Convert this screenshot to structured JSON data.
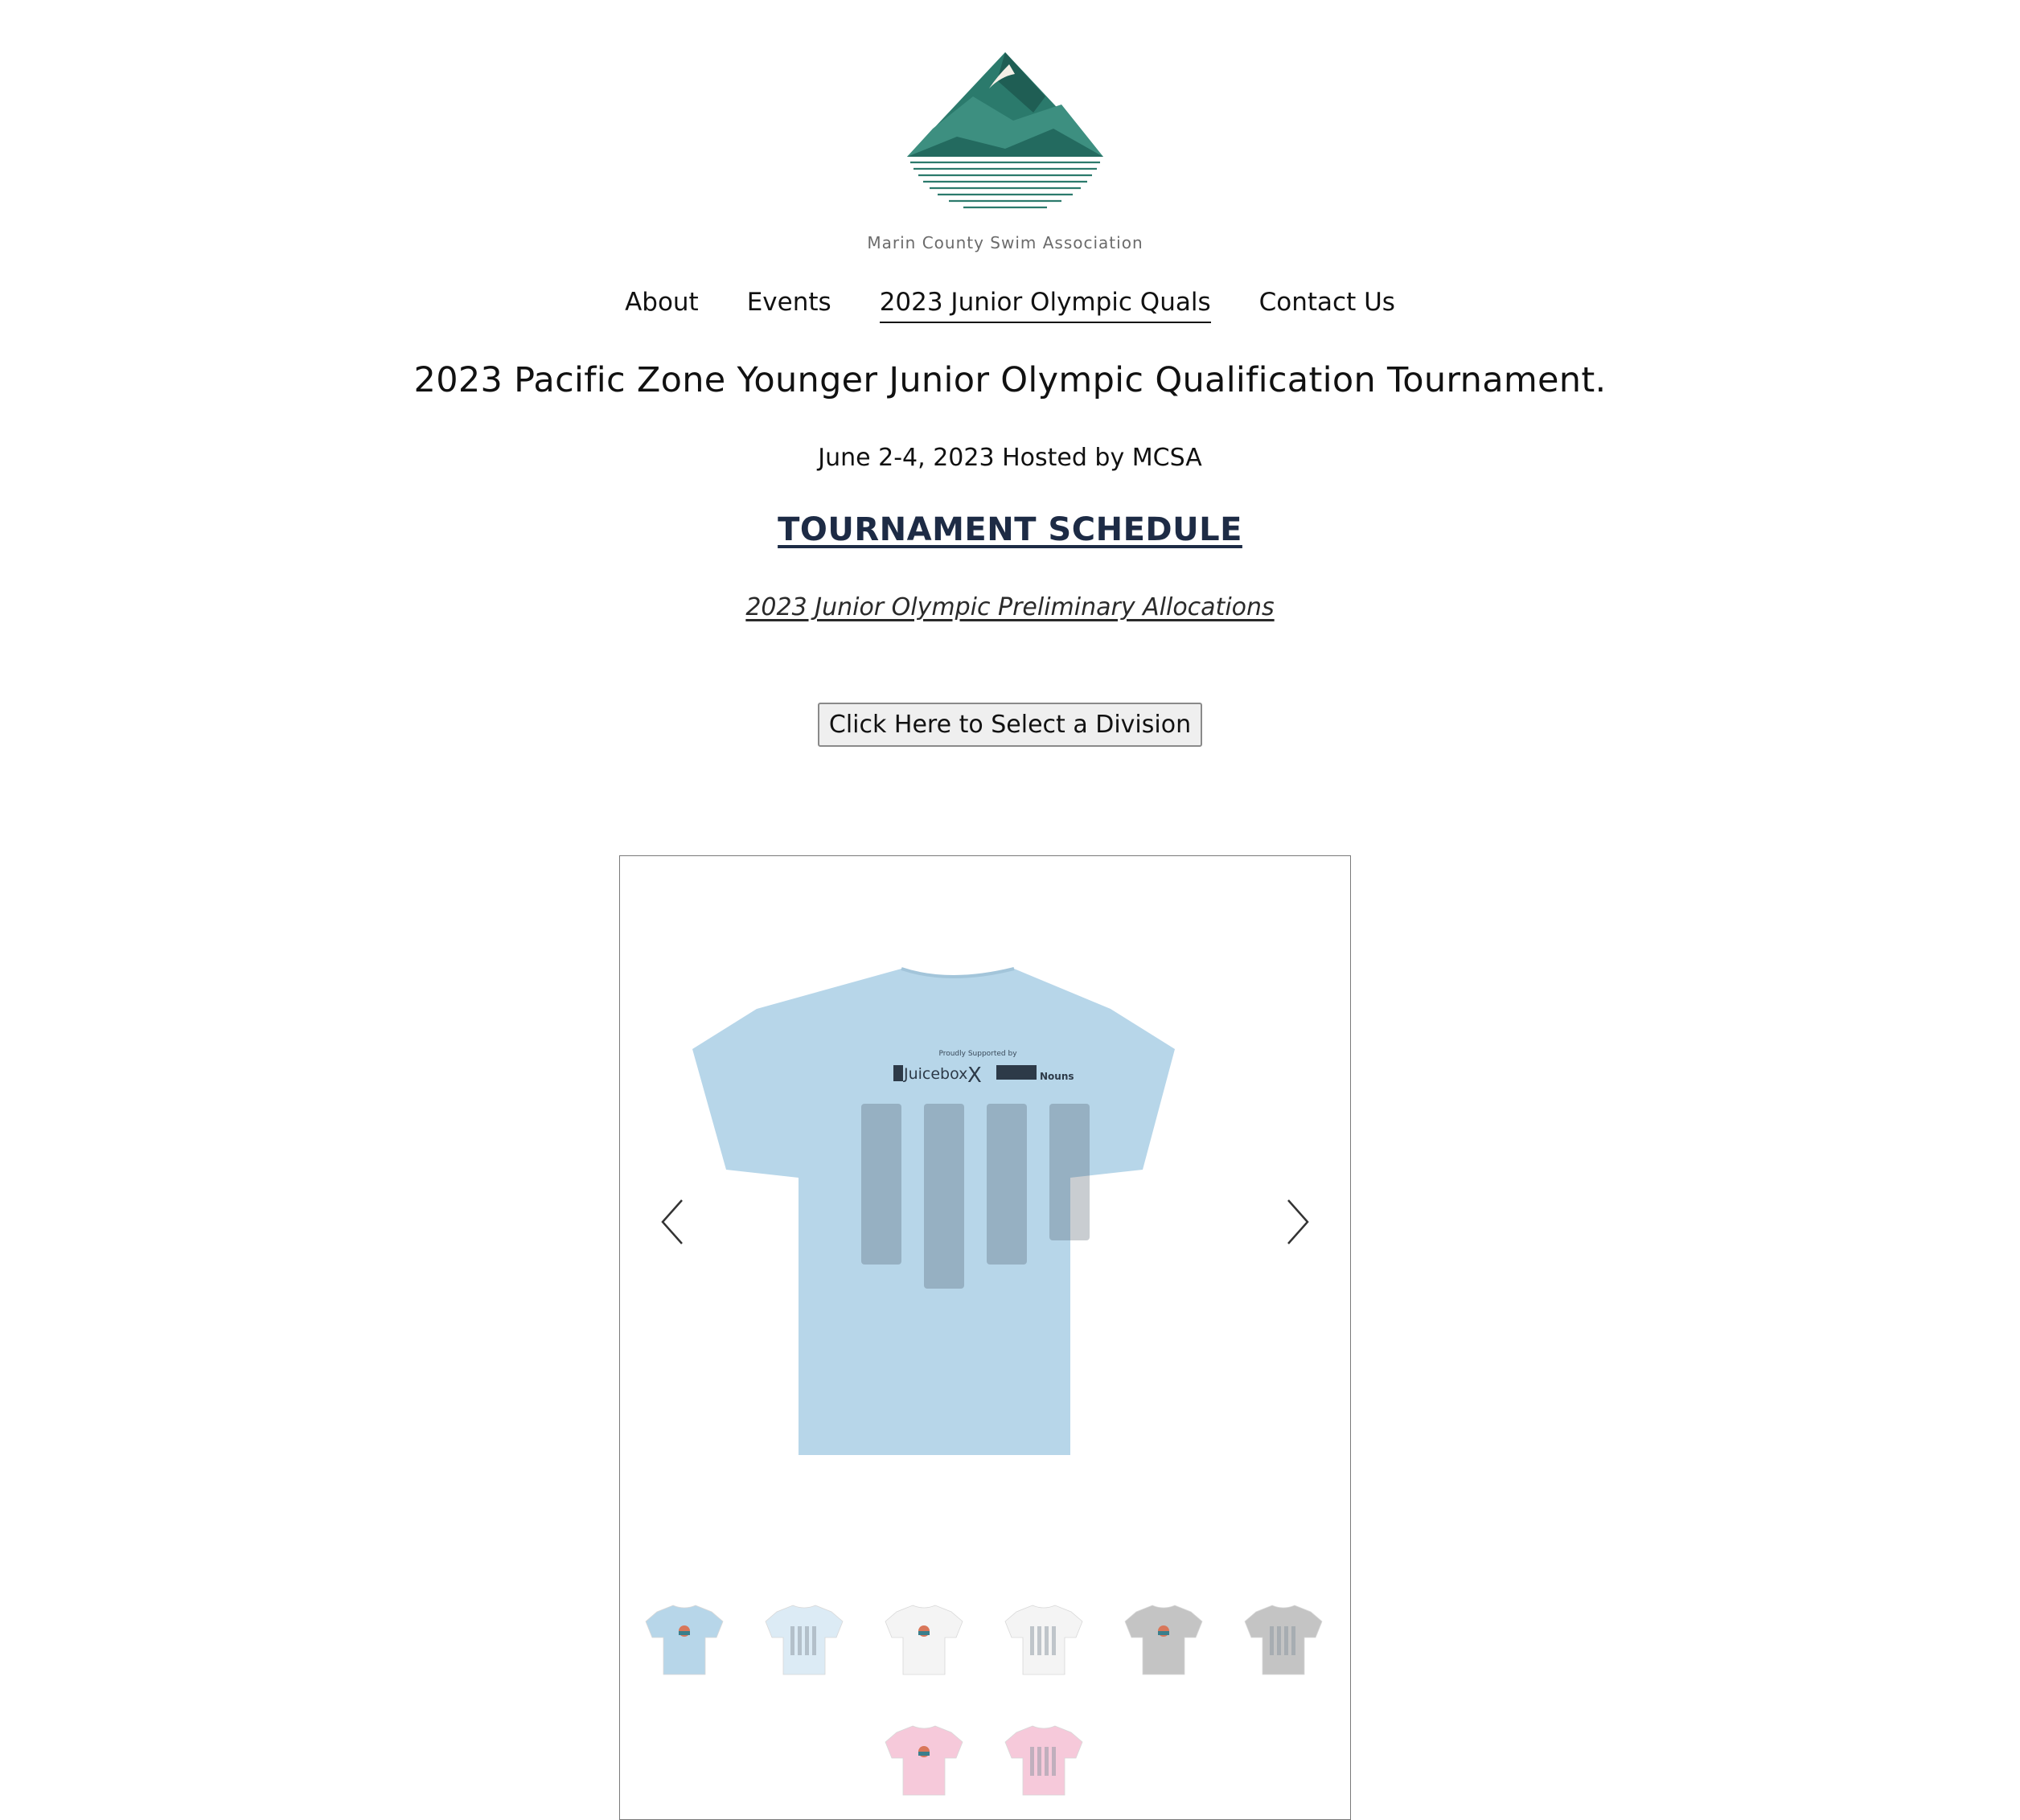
{
  "site": {
    "logo_text": "Marin County Swim Association"
  },
  "nav": {
    "items": [
      {
        "label": "About"
      },
      {
        "label": "Events"
      },
      {
        "label": "2023 Junior Olympic Quals",
        "active": true
      },
      {
        "label": "Contact Us"
      }
    ]
  },
  "main": {
    "title": "2023 Pacific Zone Younger Junior Olympic Qualification Tournament.",
    "subtitle": "June 2-4, 2023 Hosted by MCSA",
    "schedule_link": "TOURNAMENT SCHEDULE",
    "allocations_link": "2023 Junior Olympic Preliminary Allocations",
    "division_button": "Click Here to Select a Division"
  },
  "gallery": {
    "main_image": {
      "color": "#b7d6e9",
      "print_header": "Proudly Supported by",
      "sponsor_1": "Juicebox",
      "sponsor_separator": "X",
      "sponsor_2": "Nouns"
    },
    "prev_icon": "chevron-left-icon",
    "next_icon": "chevron-right-icon",
    "thumbnails": [
      {
        "color": "#b7d6e9",
        "side": "front"
      },
      {
        "color": "#dcebf5",
        "side": "back"
      },
      {
        "color": "#f4f4f4",
        "side": "front"
      },
      {
        "color": "#f4f4f4",
        "side": "back"
      },
      {
        "color": "#c4c4c4",
        "side": "front"
      },
      {
        "color": "#c4c4c4",
        "side": "back"
      },
      {
        "color": "#f6c9da",
        "side": "front"
      },
      {
        "color": "#f6c9da",
        "side": "back"
      }
    ]
  }
}
